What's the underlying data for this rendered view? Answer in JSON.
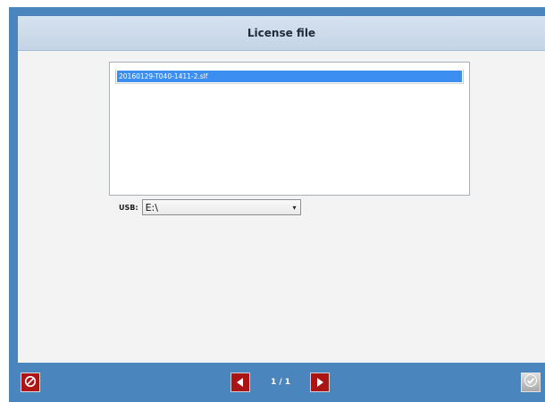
{
  "dialog": {
    "title": "License file"
  },
  "file_list": {
    "items": [
      "20160129-T040-1411-2.slf"
    ],
    "selected_index": 0
  },
  "usb": {
    "label": "USB:",
    "value": "E:\\"
  },
  "footer": {
    "page_indicator": "1 / 1",
    "buttons": [
      "cancel-icon",
      "arrow-left-icon",
      "arrow-right-icon",
      "checkmark-icon"
    ]
  },
  "colors": {
    "frame_blue": "#4a86bd",
    "button_red": "#b01515",
    "selection_blue": "#3c8ef0"
  }
}
